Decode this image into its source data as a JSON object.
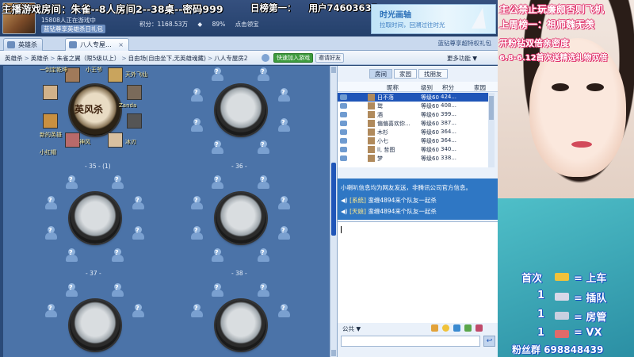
{
  "overlay": {
    "live_banner": "主播游戏房间：朱雀--8人房间2--38桌--密码999",
    "rank_title": "日榜第一：",
    "user_id": "用户74603637",
    "rules_title_1": "主公禁止玩廉颇否则飞机",
    "rules_title_2": "上周榜一：祖师魏无羡",
    "rules_title_3": "开粉钻双倍亲密度",
    "rules_title_4": "6.8-6.12首次送精选礼物双倍",
    "rule_1_num": "首次",
    "rule_1_text": "= 上车",
    "rule_2_num": "1",
    "rule_2_text": "= 插队",
    "rule_3_num": "1",
    "rule_3_text": "= 房管",
    "rule_4_num": "1",
    "rule_4_text": "= VX",
    "fan_group": "粉丝群 698848439"
  },
  "qq": {
    "status_1": "15808人正在游戏中",
    "status_2": "蓝钻尊享英雄杀日礼包",
    "score_label": "积分：1168.53万",
    "percent": "89%",
    "treasure": "点击领宝"
  },
  "ad": {
    "line1": "时光画轴",
    "line2": "拉取时间，回溯过往时光"
  },
  "tabs": [
    {
      "label": "英雄杀"
    },
    {
      "label": "八人专屋...",
      "close": "×"
    }
  ],
  "tab_right": "蓝钻尊享超特权礼包",
  "breadcrumb": [
    "英雄杀",
    "英雄杀",
    "朱雀之翼（限5级以上）",
    "自由场(自由坐下,无英雄魂藏)",
    "八人专屋房2"
  ],
  "breadcrumb_sep": ">",
  "nav": {
    "quick_join": "快速加入游戏",
    "invite": "邀请好友",
    "more": "更多功能"
  },
  "tables": [
    {
      "label": "- 35 -   (1)"
    },
    {
      "label": "- 36 -"
    },
    {
      "label": "- 37 -"
    },
    {
      "label": "- 38 -"
    }
  ],
  "hero_table_text": "英风杀",
  "occupant_names": [
    "一剑定乾坤",
    "小王爷",
    "天外飞仙",
    "Zanda",
    "新的英雄",
    "小红帽",
    "神风",
    "冰刃",
    "墨楼"
  ],
  "seat_glyph": "?",
  "player_panel": {
    "tabs": [
      "房间",
      "家园",
      "找朋友"
    ],
    "headers": {
      "nick": "昵称",
      "level": "级别",
      "score": "积分",
      "home": "家园"
    },
    "rows": [
      {
        "nick": "日不落",
        "level": "等级60",
        "score": "424..."
      },
      {
        "nick": "鹫",
        "level": "等级60",
        "score": "408..."
      },
      {
        "nick": "酒",
        "level": "等级60",
        "score": "399..."
      },
      {
        "nick": "偏偏喜欢你...",
        "level": "等级60",
        "score": "387..."
      },
      {
        "nick": "木杉",
        "level": "等级60",
        "score": "364..."
      },
      {
        "nick": "小七",
        "level": "等级60",
        "score": "364..."
      },
      {
        "nick": "ll, 哲图",
        "level": "等级60",
        "score": "340..."
      },
      {
        "nick": "梦",
        "level": "等级60",
        "score": "338..."
      }
    ]
  },
  "chat": {
    "notice": "小喇叭信息均为网友发送，非腾讯公司官方信息。",
    "msg1_tag": "[系统]",
    "msg1_text": "蛮缠4894来个队友一起杀",
    "msg2_tag": "[天娘]",
    "msg2_text": "蛮缠4894来个队友一起杀",
    "channel": "公共 ▼",
    "send_glyph": "↩"
  },
  "colors": {
    "accent": "#1f55b8",
    "panel_bg": "#eaf1fa",
    "game_bg": "#4b73a8",
    "chat_bg": "#2f77c4"
  }
}
